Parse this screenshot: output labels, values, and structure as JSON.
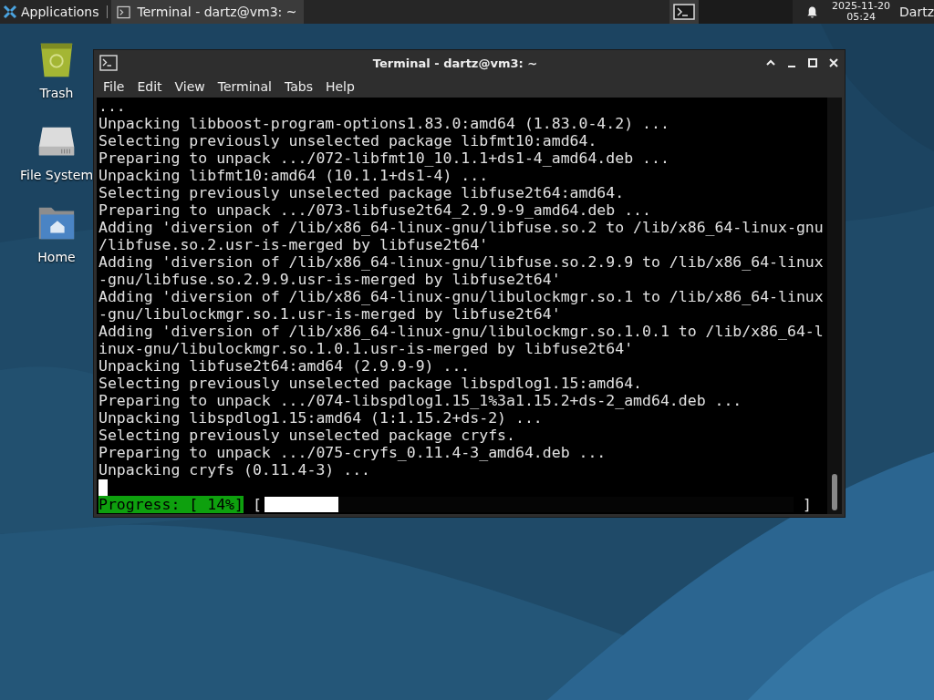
{
  "panel": {
    "menu_label": "Applications",
    "tasks": [
      {
        "label": "Terminal - dartz@vm3: ~",
        "selected": true
      }
    ],
    "clock": {
      "date": "2025-11-20",
      "time": "05:24"
    },
    "user": "Dartz"
  },
  "desktop_icons": [
    {
      "label": "Trash",
      "kind": "trash"
    },
    {
      "label": "File System",
      "kind": "drive"
    },
    {
      "label": "Home",
      "kind": "home"
    }
  ],
  "window": {
    "title": "Terminal - dartz@vm3: ~",
    "menu": [
      "File",
      "Edit",
      "View",
      "Terminal",
      "Tabs",
      "Help"
    ],
    "lines": [
      "...",
      "Unpacking libboost-program-options1.83.0:amd64 (1.83.0-4.2) ...",
      "Selecting previously unselected package libfmt10:amd64.",
      "Preparing to unpack .../072-libfmt10_10.1.1+ds1-4_amd64.deb ...",
      "Unpacking libfmt10:amd64 (10.1.1+ds1-4) ...",
      "Selecting previously unselected package libfuse2t64:amd64.",
      "Preparing to unpack .../073-libfuse2t64_2.9.9-9_amd64.deb ...",
      "Adding 'diversion of /lib/x86_64-linux-gnu/libfuse.so.2 to /lib/x86_64-linux-gnu",
      "/libfuse.so.2.usr-is-merged by libfuse2t64'",
      "Adding 'diversion of /lib/x86_64-linux-gnu/libfuse.so.2.9.9 to /lib/x86_64-linux",
      "-gnu/libfuse.so.2.9.9.usr-is-merged by libfuse2t64'",
      "Adding 'diversion of /lib/x86_64-linux-gnu/libulockmgr.so.1 to /lib/x86_64-linux",
      "-gnu/libulockmgr.so.1.usr-is-merged by libfuse2t64'",
      "Adding 'diversion of /lib/x86_64-linux-gnu/libulockmgr.so.1.0.1 to /lib/x86_64-l",
      "inux-gnu/libulockmgr.so.1.0.1.usr-is-merged by libfuse2t64'",
      "Unpacking libfuse2t64:amd64 (2.9.9-9) ...",
      "Selecting previously unselected package libspdlog1.15:amd64.",
      "Preparing to unpack .../074-libspdlog1.15_1%3a1.15.2+ds-2_amd64.deb ...",
      "Unpacking libspdlog1.15:amd64 (1:1.15.2+ds-2) ...",
      "Selecting previously unselected package cryfs.",
      "Preparing to unpack .../075-cryfs_0.11.4-3_amd64.deb ...",
      "Unpacking cryfs (0.11.4-3) ..."
    ],
    "cursor": true,
    "progress": {
      "label": "Progress: [ 14%]",
      "open": "[",
      "close": "]",
      "level": 0.14
    }
  }
}
